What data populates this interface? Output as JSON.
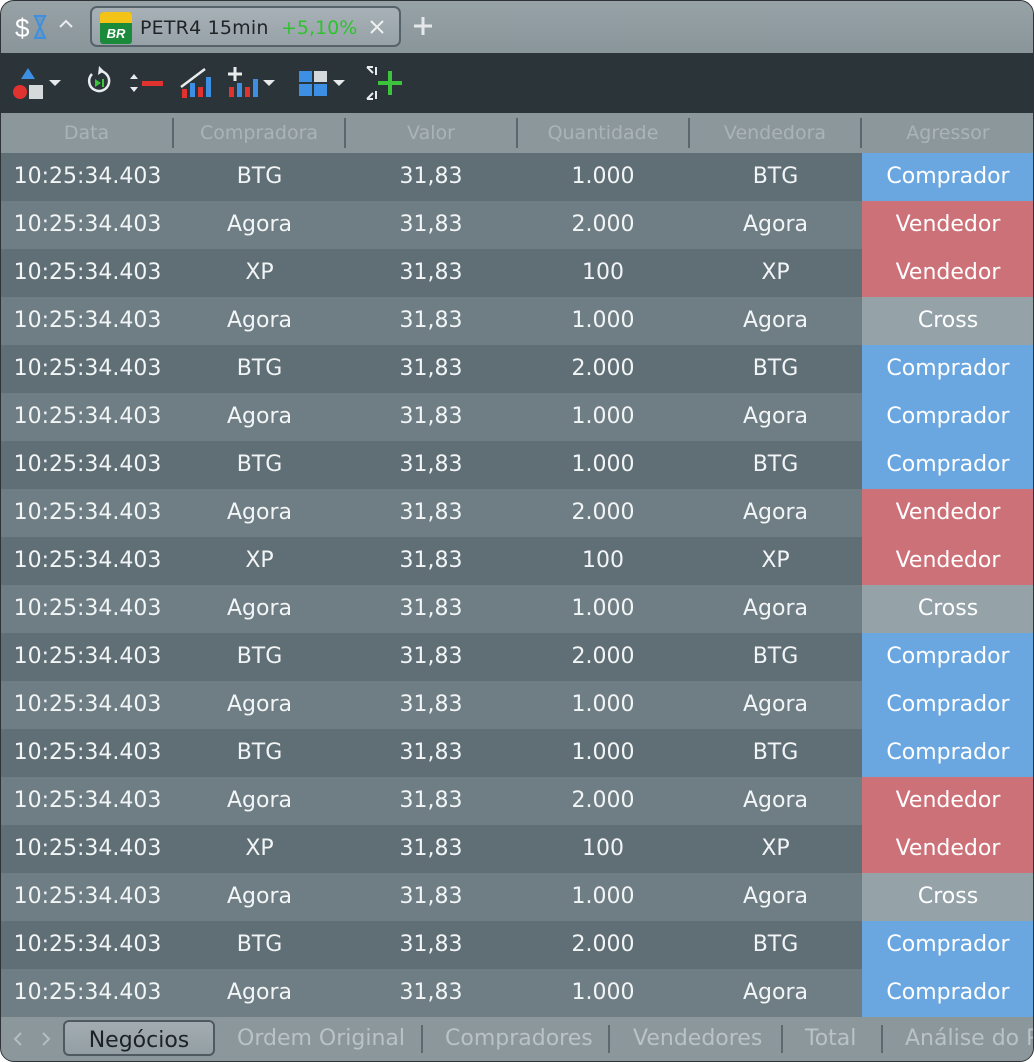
{
  "tab": {
    "symbol": "PETR4 15min",
    "change": "+5,10%",
    "logo_text": "BR"
  },
  "colors": {
    "comprador": "#6aa7e0",
    "vendedor": "#cd7179",
    "cross": "#95a3a9",
    "change_positive": "#2ec32e"
  },
  "toolbar": {
    "tools": [
      "drawing-tools-icon",
      "reset-icon",
      "zoom-out-icon",
      "candles-icon",
      "add-indicator-icon",
      "layout-icon",
      "add-panel-icon"
    ]
  },
  "table": {
    "columns": [
      "Data",
      "Compradora",
      "Valor",
      "Quantidade",
      "Vendedora",
      "Agressor"
    ],
    "rows": [
      [
        "10:25:34.403",
        "BTG",
        "31,83",
        "1.000",
        "BTG",
        "Comprador"
      ],
      [
        "10:25:34.403",
        "Agora",
        "31,83",
        "2.000",
        "Agora",
        "Vendedor"
      ],
      [
        "10:25:34.403",
        "XP",
        "31,83",
        "100",
        "XP",
        "Vendedor"
      ],
      [
        "10:25:34.403",
        "Agora",
        "31,83",
        "1.000",
        "Agora",
        "Cross"
      ],
      [
        "10:25:34.403",
        "BTG",
        "31,83",
        "2.000",
        "BTG",
        "Comprador"
      ],
      [
        "10:25:34.403",
        "Agora",
        "31,83",
        "1.000",
        "Agora",
        "Comprador"
      ],
      [
        "10:25:34.403",
        "BTG",
        "31,83",
        "1.000",
        "BTG",
        "Comprador"
      ],
      [
        "10:25:34.403",
        "Agora",
        "31,83",
        "2.000",
        "Agora",
        "Vendedor"
      ],
      [
        "10:25:34.403",
        "XP",
        "31,83",
        "100",
        "XP",
        "Vendedor"
      ],
      [
        "10:25:34.403",
        "Agora",
        "31,83",
        "1.000",
        "Agora",
        "Cross"
      ],
      [
        "10:25:34.403",
        "BTG",
        "31,83",
        "2.000",
        "BTG",
        "Comprador"
      ],
      [
        "10:25:34.403",
        "Agora",
        "31,83",
        "1.000",
        "Agora",
        "Comprador"
      ],
      [
        "10:25:34.403",
        "BTG",
        "31,83",
        "1.000",
        "BTG",
        "Comprador"
      ],
      [
        "10:25:34.403",
        "Agora",
        "31,83",
        "2.000",
        "Agora",
        "Vendedor"
      ],
      [
        "10:25:34.403",
        "XP",
        "31,83",
        "100",
        "XP",
        "Vendedor"
      ],
      [
        "10:25:34.403",
        "Agora",
        "31,83",
        "1.000",
        "Agora",
        "Cross"
      ],
      [
        "10:25:34.403",
        "BTG",
        "31,83",
        "2.000",
        "BTG",
        "Comprador"
      ],
      [
        "10:25:34.403",
        "Agora",
        "31,83",
        "1.000",
        "Agora",
        "Comprador"
      ]
    ]
  },
  "bottom_tabs": [
    {
      "label": "Negócios",
      "active": true
    },
    {
      "label": "Ordem Original",
      "active": false
    },
    {
      "label": "Compradores",
      "active": false
    },
    {
      "label": "Vendedores",
      "active": false
    },
    {
      "label": "Total",
      "active": false
    },
    {
      "label": "Análise do P",
      "active": false
    }
  ]
}
